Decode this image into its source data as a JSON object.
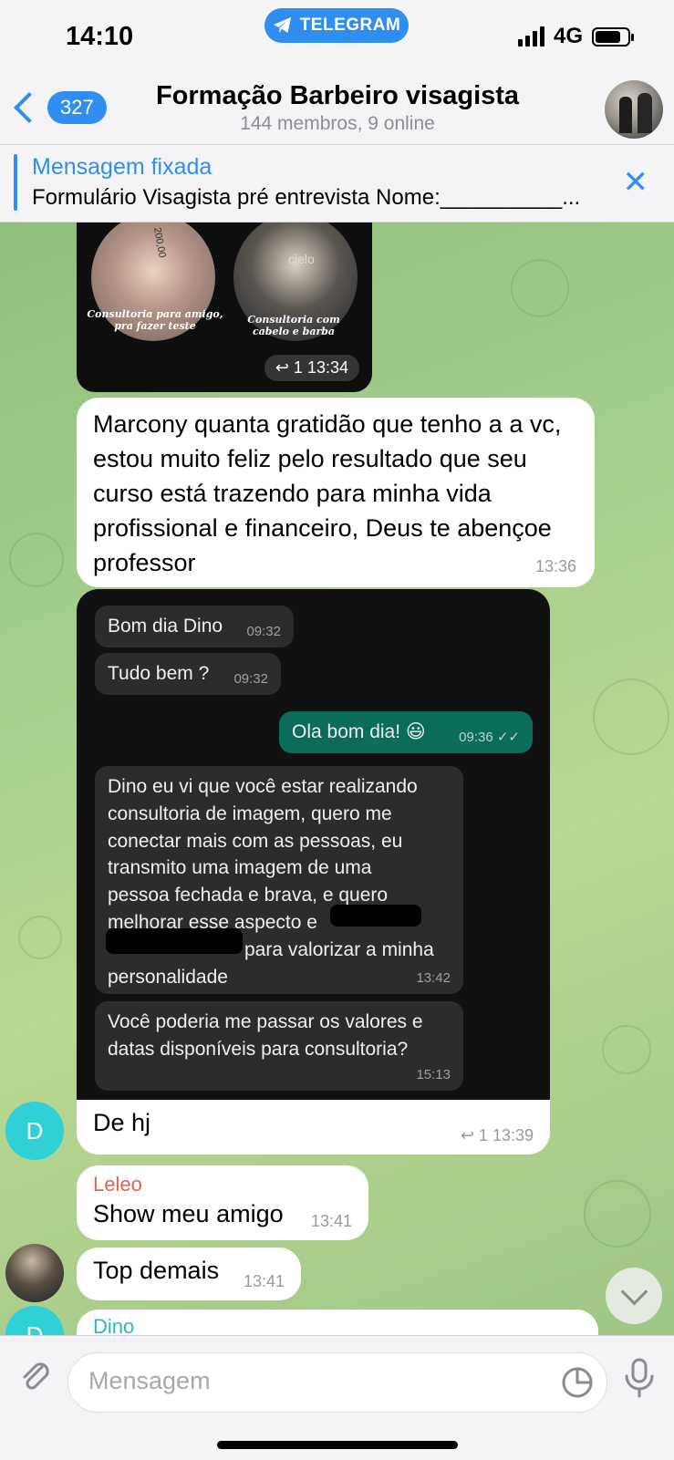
{
  "status_bar": {
    "time": "14:10",
    "telegram_label": "TELEGRAM",
    "network": "4G"
  },
  "header": {
    "back_count": "327",
    "title": "Formação Barbeiro visagista",
    "subtitle": "144 membros, 9 online"
  },
  "pinned": {
    "title": "Mensagem fixada",
    "text": "Formulário Visagista pré entrevista Nome:__________..."
  },
  "messages": {
    "image_card": {
      "caption_left": "Consultoria para amigo, pra fazer teste",
      "caption_right": "Consultoria com cabelo e barba",
      "replies": "1",
      "time": "13:34",
      "receipt_top": "200,00",
      "price_tag": "cielo"
    },
    "gratitude": {
      "text": "Marcony quanta gratidão que tenho a a vc, estou muito feliz pelo resultado que seu curso está trazendo para minha vida profissional e financeiro, Deus te abençoe professor",
      "time": "13:36"
    },
    "screenshot": {
      "msg1": "Bom dia Dino",
      "msg1_time": "09:32",
      "msg2": "Tudo bem ?",
      "msg2_time": "09:32",
      "msg3": "Ola bom dia! 😃",
      "msg3_time": "09:36",
      "msg4_line1": "Dino eu vi que você estar realizando",
      "msg4_line2": "consultoria de imagem, quero me",
      "msg4_line3": "conectar mais com as pessoas, eu",
      "msg4_line4": "transmito uma imagem de uma",
      "msg4_line5": "pessoa fechada e brava, e quero",
      "msg4_line6": "melhorar esse aspecto e",
      "msg4_line7": "para valorizar a minha",
      "msg4_line8": "personalidade",
      "msg4_time": "13:42",
      "msg5": "Você poderia me passar os valores e datas disponíveis para consultoria?",
      "msg5_time": "15:13"
    },
    "dehj": {
      "text": "De hj",
      "replies": "1",
      "time": "13:39",
      "avatar_letter": "D"
    },
    "leleo": {
      "sender": "Leleo",
      "text": "Show meu amigo",
      "time": "13:41"
    },
    "top": {
      "text": "Top demais",
      "time": "13:41"
    },
    "dino_partial": {
      "sender": "Dino",
      "avatar_letter": "D"
    }
  },
  "input": {
    "placeholder": "Mensagem"
  },
  "colors": {
    "accent": "#2f8ef0",
    "leleo": "#e8604f",
    "dino": "#2ab7c0",
    "avatar_d": "#2fd0d6"
  }
}
